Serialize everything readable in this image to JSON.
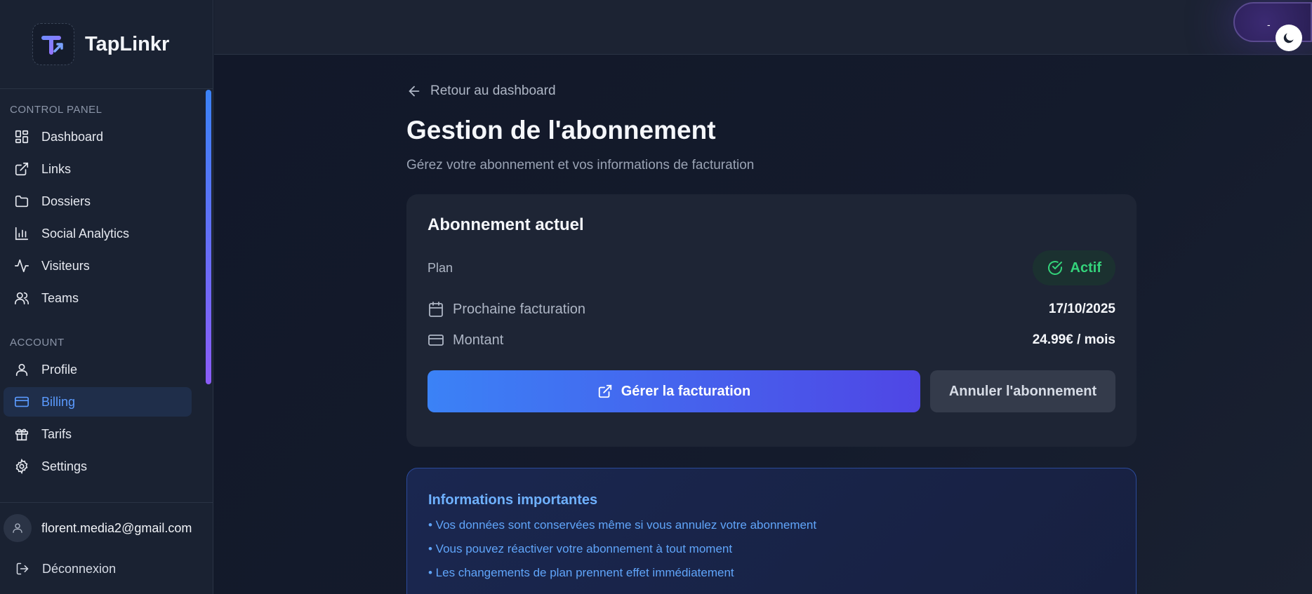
{
  "brand": {
    "name": "TapLinkr"
  },
  "sidebar": {
    "sections": [
      {
        "label": "CONTROL PANEL",
        "items": [
          {
            "label": "Dashboard",
            "icon": "dashboard-icon"
          },
          {
            "label": "Links",
            "icon": "external-link-icon"
          },
          {
            "label": "Dossiers",
            "icon": "folder-icon"
          },
          {
            "label": "Social Analytics",
            "icon": "bar-chart-icon"
          },
          {
            "label": "Visiteurs",
            "icon": "activity-icon"
          },
          {
            "label": "Teams",
            "icon": "users-icon"
          }
        ]
      },
      {
        "label": "ACCOUNT",
        "items": [
          {
            "label": "Profile",
            "icon": "user-icon"
          },
          {
            "label": "Billing",
            "icon": "credit-card-icon",
            "active": true
          },
          {
            "label": "Tarifs",
            "icon": "gift-icon"
          },
          {
            "label": "Settings",
            "icon": "gear-icon"
          }
        ]
      }
    ],
    "user_email": "florent.media2@gmail.com",
    "logout_label": "Déconnexion"
  },
  "topbar": {
    "theme_toggle_text": "-"
  },
  "main": {
    "back_label": "Retour au dashboard",
    "title": "Gestion de l'abonnement",
    "subtitle": "Gérez votre abonnement et vos informations de facturation",
    "card": {
      "title": "Abonnement actuel",
      "plan_label": "Plan",
      "status": "Actif",
      "next_billing_label": "Prochaine facturation",
      "next_billing_value": "17/10/2025",
      "amount_label": "Montant",
      "amount_value": "24.99€ / mois",
      "manage_button": "Gérer la facturation",
      "cancel_button": "Annuler l'abonnement"
    },
    "notice": {
      "title": "Informations importantes",
      "items": [
        "• Vos données sont conservées même si vous annulez votre abonnement",
        "• Vous pouvez réactiver votre abonnement à tout moment",
        "• Les changements de plan prennent effet immédiatement"
      ]
    }
  },
  "colors": {
    "accent": "#3b82f6",
    "accent_end": "#4f46e5",
    "success": "#34d47b",
    "active_nav": "#5b9bff"
  }
}
